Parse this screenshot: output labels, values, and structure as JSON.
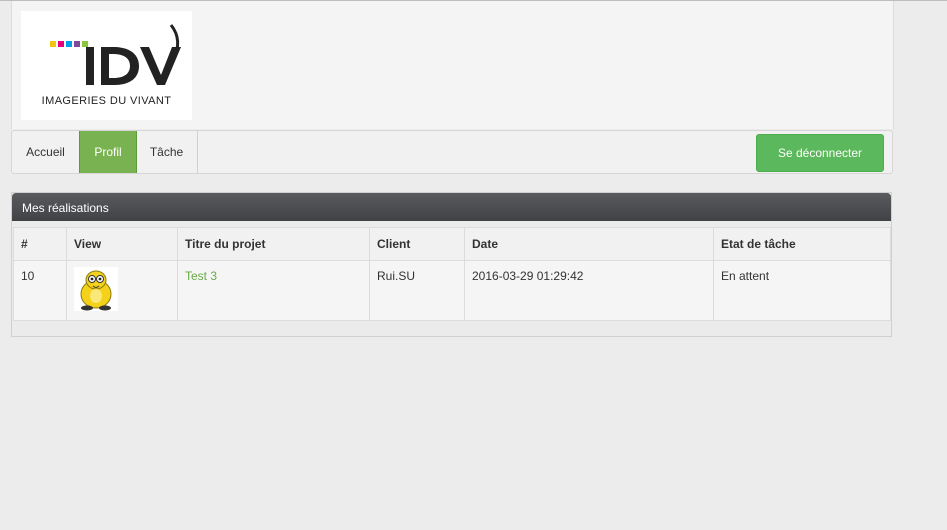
{
  "logo": {
    "brand_text": "IDV",
    "tagline": "IMAGERIES DU VIVANT",
    "dot_colors": [
      "#f1c40f",
      "#e4007c",
      "#00a0e9",
      "#7d4b9a",
      "#8cc63f"
    ]
  },
  "nav": {
    "items": [
      {
        "label": "Accueil",
        "active": false
      },
      {
        "label": "Profil",
        "active": true
      },
      {
        "label": "Tâche",
        "active": false
      }
    ],
    "logout_label": "Se déconnecter"
  },
  "panel": {
    "title": "Mes réalisations",
    "columns": [
      "#",
      "View",
      "Titre du projet",
      "Client",
      "Date",
      "Etat de tâche"
    ],
    "rows": [
      {
        "id": "10",
        "view_icon": "penguin-thumbnail",
        "project": "Test 3",
        "client": "Rui.SU",
        "date": "2016-03-29 01:29:42",
        "status": "En attent"
      }
    ]
  },
  "colors": {
    "accent_green": "#79b351",
    "button_green": "#5cb85c",
    "link_green": "#6aaa48",
    "panel_header": "#4a4b4f"
  }
}
